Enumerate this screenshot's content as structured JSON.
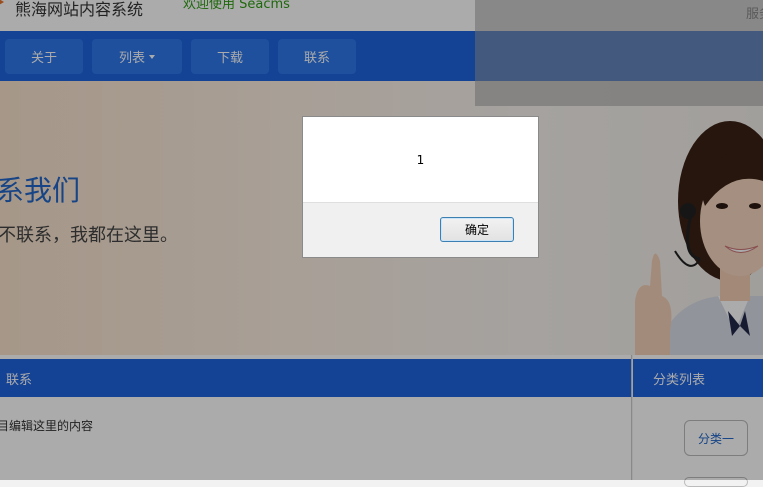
{
  "header": {
    "site_title": "熊海网站内容系统",
    "welcome_text": "欢迎使用 Seacms",
    "service_text": "服务"
  },
  "nav": {
    "items": [
      {
        "label": "关于"
      },
      {
        "label": "列表",
        "has_dropdown": true
      },
      {
        "label": "下载"
      },
      {
        "label": "联系"
      }
    ]
  },
  "banner": {
    "title": "系我们",
    "subtitle": "不联系，我都在这里。"
  },
  "content": {
    "heading": "联系",
    "body": "目编辑这里的内容"
  },
  "sidebar": {
    "heading": "分类列表",
    "category_button": "分类一"
  },
  "dialog": {
    "message": "1",
    "ok_label": "确定"
  },
  "colors": {
    "nav_blue": "#1e64e0",
    "button_blue": "#2d78ec",
    "link_blue": "#2166c8",
    "welcome_green": "#2e9c12"
  }
}
